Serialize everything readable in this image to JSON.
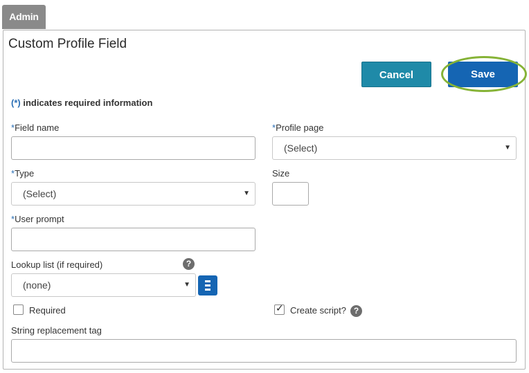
{
  "tab": {
    "label": "Admin"
  },
  "page": {
    "title": "Custom Profile Field"
  },
  "buttons": {
    "cancel": "Cancel",
    "save": "Save"
  },
  "required_note": {
    "star": "(*)",
    "text": " indicates required information"
  },
  "fields": {
    "field_name": {
      "star": "*",
      "label": "Field name",
      "value": ""
    },
    "profile_page": {
      "star": "*",
      "label": "Profile page",
      "selected": "(Select)"
    },
    "type": {
      "star": "*",
      "label": "Type",
      "selected": "(Select)"
    },
    "size": {
      "label": "Size",
      "value": ""
    },
    "user_prompt": {
      "star": "*",
      "label": "User prompt",
      "value": ""
    },
    "lookup_list": {
      "label": "Lookup list (if required)",
      "selected": "(none)"
    },
    "required": {
      "label": "Required",
      "checked": false
    },
    "create_script": {
      "label": "Create script?",
      "checked": true
    },
    "string_replacement_tag": {
      "label": "String replacement tag",
      "value": ""
    }
  },
  "icons": {
    "help": "?",
    "caret": "▼",
    "check": "✓",
    "lookup": "list-icon"
  },
  "colors": {
    "tab_bg": "#8a8a8a",
    "cancel_bg": "#1f8aa8",
    "save_bg": "#1565b3",
    "highlight_ring": "#86b336",
    "required_star": "#2a6fb5"
  }
}
